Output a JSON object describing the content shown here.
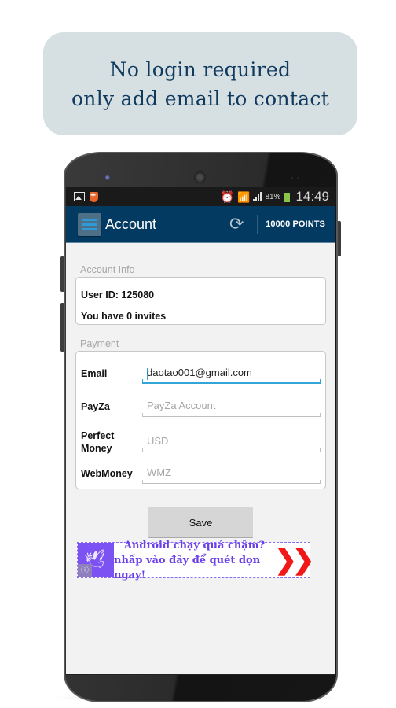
{
  "caption": {
    "line1": "No login required",
    "line2": "only add email to contact"
  },
  "statusbar": {
    "left_icons": [
      "gallery-icon",
      "shield-icon"
    ],
    "right_icons": [
      "alarm-icon",
      "wifi-icon",
      "signal-icon",
      "battery-icon"
    ],
    "battery_percent": "81%",
    "time": "14:49"
  },
  "actionbar": {
    "title": "Account",
    "refresh_glyph": "⟳",
    "points": "10000 POINTS"
  },
  "account_info": {
    "section_label": "Account Info",
    "user_id": "User ID: 125080",
    "invites": "You have 0 invites"
  },
  "payment": {
    "section_label": "Payment",
    "fields": [
      {
        "label": "Email",
        "value": "daotao001@gmail.com",
        "placeholder": ""
      },
      {
        "label": "PayZa",
        "value": "",
        "placeholder": "PayZa Account"
      },
      {
        "label": "Perfect Money",
        "value": "",
        "placeholder": "USD"
      },
      {
        "label": "WebMoney",
        "value": "",
        "placeholder": "WMZ"
      }
    ]
  },
  "save_label": "Save",
  "ad": {
    "line1": "Android chạy quá chậm?",
    "line2": "nhấp vào đây để quét dọn ngay!",
    "arrows": "❯❯",
    "info_glyph": "ⓘ",
    "colors": {
      "brand": "#7c52f2",
      "text": "#6a3ee8",
      "arrow": "#f01818"
    }
  },
  "colors": {
    "actionbar": "#033a62",
    "accent": "#33a5d6",
    "caption_bg": "#d6dfe2",
    "caption_text": "#0f3a5e"
  }
}
